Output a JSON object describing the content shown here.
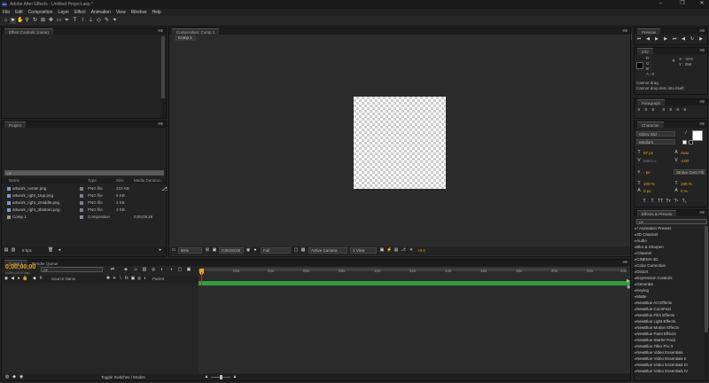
{
  "window": {
    "app_icon_text": "Ae",
    "title": "Adobe After Effects - Untitled Project.aep *",
    "minimize": "–",
    "maximize": "❐",
    "close": "✕"
  },
  "menu": [
    "File",
    "Edit",
    "Composition",
    "Layer",
    "Effect",
    "Animation",
    "View",
    "Window",
    "Help"
  ],
  "toolbar": {
    "snapping_label": "Snapping",
    "workspace_label": "Workspace:",
    "workspace_value": "All Panels",
    "search_placeholder": "Search Help"
  },
  "effect_controls": {
    "tab_label": "Effect Controls: (none)"
  },
  "composition": {
    "tab_label": "Composition: Comp 1",
    "subtab": "Comp 1",
    "zoom": "50%",
    "timecode": "0;00;00;00",
    "resolution": "Full",
    "camera": "Active Camera",
    "views": "1 View",
    "exposure": "+0.0"
  },
  "project": {
    "tab_label": "Project",
    "search_placeholder": "ρ▾",
    "columns": [
      "Name",
      "Type",
      "Size",
      "Media Duration"
    ],
    "items": [
      {
        "name": "artwork_center.png",
        "type": "PNG file",
        "size": "215 KB",
        "duration": ""
      },
      {
        "name": "artwork_right_1top.png",
        "type": "PNG file",
        "size": "5 KB",
        "duration": ""
      },
      {
        "name": "artwork_right_2middle.png",
        "type": "PNG file",
        "size": "3 KB",
        "duration": ""
      },
      {
        "name": "artwork_right_3bottom.png",
        "type": "PNG file",
        "size": "3 KB",
        "duration": ""
      },
      {
        "name": "Comp 1",
        "type": "Composition",
        "size": "",
        "duration": "0;00;09;28"
      }
    ],
    "bpc": "8 bpc"
  },
  "timeline": {
    "tab_comp": "Comp 1",
    "tab_render": "Render Queue",
    "timecode": "0;00;00;00",
    "fps": "00000 (29.97 fps)",
    "search_placeholder": "ρ▾",
    "col_source": "Source Name",
    "col_parent": "Parent",
    "ruler": [
      "0s",
      "02s",
      "04s",
      "06s",
      "08s",
      "10s",
      "12s",
      "14s",
      "16s",
      "18s",
      "20s",
      "22s",
      "24s",
      "26s",
      "28s",
      "30s",
      "32s",
      "34s"
    ],
    "toggle_label": "Toggle Switches / Modes"
  },
  "preview": {
    "tab_label": "Preview"
  },
  "info": {
    "tab_label": "Info",
    "r": "R :",
    "g": "G :",
    "b": "B :",
    "a": "A : 0",
    "x": "X : -974",
    "y": "Y : 256",
    "message_1": "Cannot drag.",
    "message_2": "Cannot drop item into itself."
  },
  "paragraph": {
    "tab_label": "Paragraph"
  },
  "character": {
    "tab_label": "Character",
    "font": "Gilroy Std",
    "style": "Medium",
    "size": "97 px",
    "leading": "Auto",
    "kerning": "Metrics",
    "tracking": "-100",
    "stroke_width": "- px",
    "stroke_mode": "Stroke Over Fill",
    "vscale": "100 %",
    "hscale": "100 %",
    "baseline": "0 px",
    "tsume": "0 %"
  },
  "effects_presets": {
    "tab_label": "Effects & Presets",
    "search_placeholder": "ρ▾",
    "items": [
      "* Animation Presets",
      "3D Channel",
      "Audio",
      "Blur & Sharpen",
      "Channel",
      "CINEMA 4D",
      "Color Correction",
      "Distort",
      "Expression Controls",
      "Generate",
      "Keying",
      "Matte",
      "NewBlue Art Effects",
      "NewBlue ColorFast",
      "NewBlue Film Effects",
      "NewBlue Light Effects",
      "NewBlue Motion Effects",
      "NewBlue Paint Effects",
      "NewBlue Starter Pack",
      "NewBlue Titler Pro 3",
      "NewBlue Video Essentials",
      "NewBlue Video Essentials II",
      "NewBlue Video Essentials III",
      "NewBlue Video Essentials IV"
    ]
  },
  "colors": {
    "accent": "#e8a917",
    "timeline_green": "#2e9e3e",
    "playhead": "#c03030"
  }
}
